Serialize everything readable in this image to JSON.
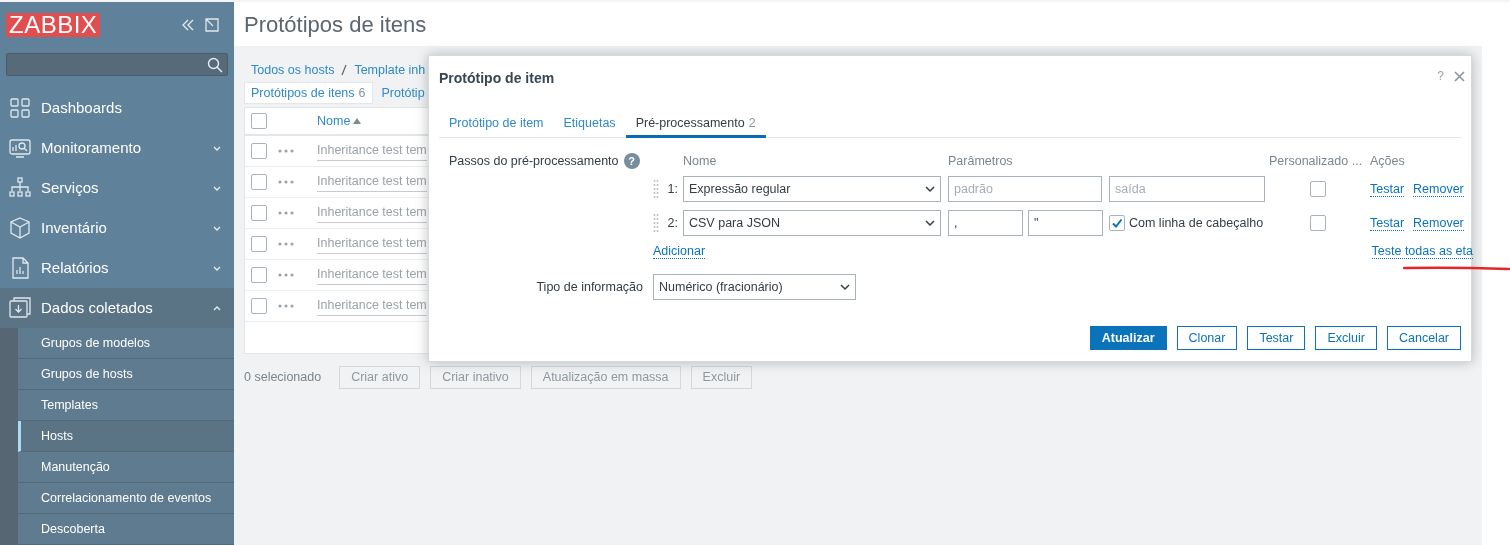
{
  "sidebar": {
    "logo": "ZABBIX",
    "items": [
      {
        "label": "Dashboards",
        "kind": "link",
        "expanded": false
      },
      {
        "label": "Monitoramento",
        "kind": "menu",
        "expanded": false
      },
      {
        "label": "Serviços",
        "kind": "menu",
        "expanded": false
      },
      {
        "label": "Inventário",
        "kind": "menu",
        "expanded": false
      },
      {
        "label": "Relatórios",
        "kind": "menu",
        "expanded": false
      },
      {
        "label": "Dados coletados",
        "kind": "menu",
        "expanded": true,
        "children": [
          {
            "label": "Grupos de modelos",
            "selected": false
          },
          {
            "label": "Grupos de hosts",
            "selected": false
          },
          {
            "label": "Templates",
            "selected": false
          },
          {
            "label": "Hosts",
            "selected": true
          },
          {
            "label": "Manutenção",
            "selected": false
          },
          {
            "label": "Correlacionamento de eventos",
            "selected": false
          },
          {
            "label": "Descoberta",
            "selected": false
          }
        ]
      }
    ]
  },
  "main": {
    "title": "Protótipos de itens",
    "breadcrumb": [
      "Todos os hosts",
      "Template inh"
    ],
    "tabs": [
      {
        "label": "Protótipos de itens",
        "count": "6",
        "selected": true
      },
      {
        "label": "Protótip",
        "selected": false
      }
    ],
    "table": {
      "all_checked": false,
      "column": "Nome",
      "sorted": true,
      "rows": [
        {
          "name": "Inheritance test tem",
          "checked": false
        },
        {
          "name": "Inheritance test tem",
          "checked": false
        },
        {
          "name": "Inheritance test tem",
          "checked": false
        },
        {
          "name": "Inheritance test tem",
          "checked": false
        },
        {
          "name": "Inheritance test tem",
          "checked": false
        },
        {
          "name": "Inheritance test tem",
          "checked": false
        }
      ]
    },
    "selected_count": "0 selecionado",
    "buttons": [
      {
        "label": "Criar ativo",
        "disabled": true
      },
      {
        "label": "Criar inativo",
        "disabled": true
      },
      {
        "label": "Atualização em massa",
        "disabled": true
      },
      {
        "label": "Excluir",
        "disabled": true
      }
    ]
  },
  "dialog": {
    "title": "Protótipo de item",
    "help": "?",
    "tabs": [
      {
        "label": "Protótipo de item",
        "selected": false
      },
      {
        "label": "Etiquetas",
        "selected": false
      },
      {
        "label": "Pré-processamento",
        "count": "2",
        "selected": true
      }
    ],
    "steps_label": "Passos do pré-processamento",
    "steps_help": "?",
    "columns": [
      "Nome",
      "Parâmetros",
      "Personalizado ...",
      "Ações"
    ],
    "steps": [
      {
        "number": "1:",
        "name": "Expressão regular",
        "kind": "regex",
        "params": [
          {
            "placeholder": "padrão"
          },
          {
            "placeholder": "saída"
          }
        ],
        "custom": false,
        "actions": [
          "Testar",
          "Remover"
        ]
      },
      {
        "number": "2:",
        "name": "CSV para JSON",
        "kind": "csv",
        "params": [
          {
            "value": ","
          },
          {
            "value": "\""
          }
        ],
        "header_option": {
          "label": "Com linha de cabeçalho",
          "checked": true
        },
        "custom": false,
        "actions": [
          "Testar",
          "Remover"
        ]
      }
    ],
    "add_link": "Adicionar",
    "test_all_link": "Teste todas as eta",
    "info_type": {
      "label": "Tipo de informação",
      "value": "Numérico (fracionário)"
    },
    "buttons": [
      {
        "label": "Atualizar",
        "kind": "primary"
      },
      {
        "label": "Clonar",
        "kind": "secondary"
      },
      {
        "label": "Testar",
        "kind": "secondary"
      },
      {
        "label": "Excluir",
        "kind": "secondary"
      },
      {
        "label": "Cancelar",
        "kind": "secondary"
      }
    ]
  }
}
